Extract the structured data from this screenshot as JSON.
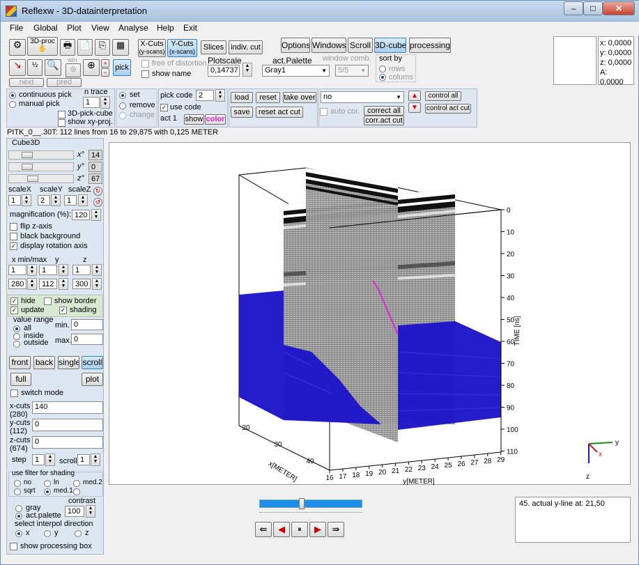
{
  "window": {
    "title": "Reflexw - 3D-datainterpretation"
  },
  "menu": [
    "File",
    "Global",
    "Plot",
    "View",
    "Analyse",
    "Help",
    "Exit"
  ],
  "toolbar": {
    "proc3d": "3D-proc",
    "win_label": "win",
    "next": "next",
    "pred": "pred",
    "pick": "pick",
    "xcuts": "X-Cuts",
    "xcuts_sub": "(y-scans)",
    "ycuts": "Y-Cuts",
    "ycuts_sub": "(x-scans)",
    "slices": "Slices",
    "indiv_cut": "indiv. cut",
    "free_distortion": "free of distortion",
    "show_name": "show name",
    "plotscale_label": "Plotscale",
    "plotscale_value": "0,14737",
    "act_palette_label": "act.Palette",
    "palette_value": "Gray1",
    "window_comb_label": "window comb.",
    "window_comb_value": "5/5",
    "options": "Options",
    "windows": "Windows",
    "scroll": "Scroll",
    "cube3d": "3D-cube",
    "processing": "processing",
    "sort_by": "sort by",
    "rows": "rows",
    "colums": "colums"
  },
  "coords": {
    "x": "x: 0,0000",
    "y": "y: 0,0000",
    "z": "z: 0,0000",
    "a": "A: 0,0000"
  },
  "pickbar": {
    "continuous_pick": "continuous pick",
    "manual_pick": "manual pick",
    "n_trace_label": "n trace",
    "n_trace_value": "1",
    "pick_cube": "3D-pick-cube",
    "show_xy_proj": "show xy-proj.",
    "set": "set",
    "remove": "remove",
    "change": "change",
    "pick_code_label": "pick code",
    "pick_code_value": "2",
    "use_code": "use code",
    "act_label": "act 1",
    "show": "show",
    "color": "color",
    "load": "load",
    "reset": "reset",
    "take_over": "take over",
    "save": "save",
    "reset_act_cut": "reset act cut",
    "combo_value": "no",
    "auto_cor": "auto cor.",
    "correct_all": "correct all",
    "corr_act_cut": "corr.act cut",
    "control_all": "control all",
    "control_act_cut": "control act cut"
  },
  "status_line": "PITK_0__.30T: 112 lines from 16 to 29,875 with 0,125 METER",
  "left": {
    "cube_label": "Cube3D",
    "x_deg": "14",
    "y_deg": "0",
    "z_deg": "67",
    "scalex_label": "scaleX",
    "scaley_label": "scaleY",
    "scalez_label": "scaleZ",
    "scalex": "1",
    "scaley": "2",
    "scalez": "1",
    "magnification_label": "magnification (%):",
    "magnification": "120",
    "flip_z": "flip z-axis",
    "black_bg": "black background",
    "display_rot": "display rotation axis",
    "minmax_label": "x min/max",
    "y_label": "y",
    "z_label": "z",
    "xmin": "1",
    "ymin": "1",
    "zmin": "1",
    "xmax": "280",
    "ymax": "112",
    "zmax": "300",
    "hide": "hide",
    "show_border": "show border",
    "update": "update",
    "shading": "shading",
    "value_range": "value range",
    "all": "all",
    "inside": "inside",
    "outside": "outside",
    "min_label": "min.",
    "max_label": "max.",
    "min_value": "0",
    "max_value": "0",
    "front": "front",
    "back": "back",
    "single": "single",
    "scroll": "scroll",
    "full": "full",
    "plot": "plot",
    "switch_mode": "switch mode",
    "xcuts_label": "x-cuts",
    "xcuts_count": "(280)",
    "xcuts_value": "140",
    "ycuts_label": "y-cuts",
    "ycuts_count": "(112)",
    "ycuts_value": "0",
    "zcuts_label": "z-cuts",
    "zcuts_count": "(674)",
    "zcuts_value": "0",
    "step_label": "step",
    "step_value": "1",
    "scroll_label": "scroll",
    "scroll_value": "1",
    "filter_label": "use filter for shading",
    "f_no": "no",
    "f_ln": "ln",
    "f_med2": "med.2",
    "f_sqrt": "sqrt",
    "f_med1": "med.1",
    "gray": "gray",
    "act_palette": "act.palette",
    "contrast_label": "contrast",
    "contrast_value": "100",
    "interpol_label": "select interpol direction",
    "ix": "x",
    "iy": "y",
    "iz": "z",
    "show_proc_box": "show processing box"
  },
  "plot": {
    "time_axis_label": "TIME [ns]",
    "time_ticks": [
      "0",
      "10",
      "20",
      "30",
      "40",
      "50",
      "60",
      "70",
      "80",
      "90",
      "100",
      "110"
    ],
    "y_axis_label": "y[METER]",
    "y_ticks": [
      "16",
      "17",
      "18",
      "19",
      "20",
      "21",
      "22",
      "23",
      "24",
      "25",
      "26",
      "27",
      "28",
      "29"
    ],
    "x_axis_label": "x[METER]",
    "x_ticks": [
      "20",
      "30",
      "40"
    ],
    "triad": {
      "x": "x",
      "y": "y",
      "z": "z"
    }
  },
  "bottom": {
    "info": "45. actual y-line at: 21,50",
    "scroll_fraction": 0.4
  }
}
